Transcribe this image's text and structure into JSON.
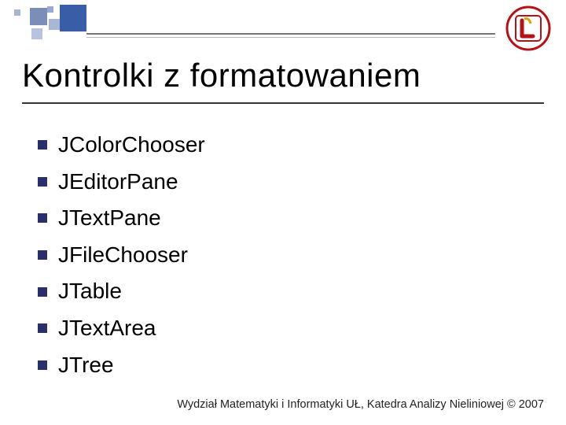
{
  "heading": "Kontrolki z formatowaniem",
  "bullets": {
    "items": [
      {
        "label": "JColorChooser"
      },
      {
        "label": "JEditorPane"
      },
      {
        "label": "JTextPane"
      },
      {
        "label": "JFileChooser"
      },
      {
        "label": "JTable"
      },
      {
        "label": "JTextArea"
      },
      {
        "label": "JTree"
      }
    ]
  },
  "footer": "Wydział Matematyki i Informatyki UŁ, Katedra Analizy Nieliniowej © 2007",
  "colors": {
    "accent": "#3a5da8",
    "bullet": "#2a2f6b"
  }
}
